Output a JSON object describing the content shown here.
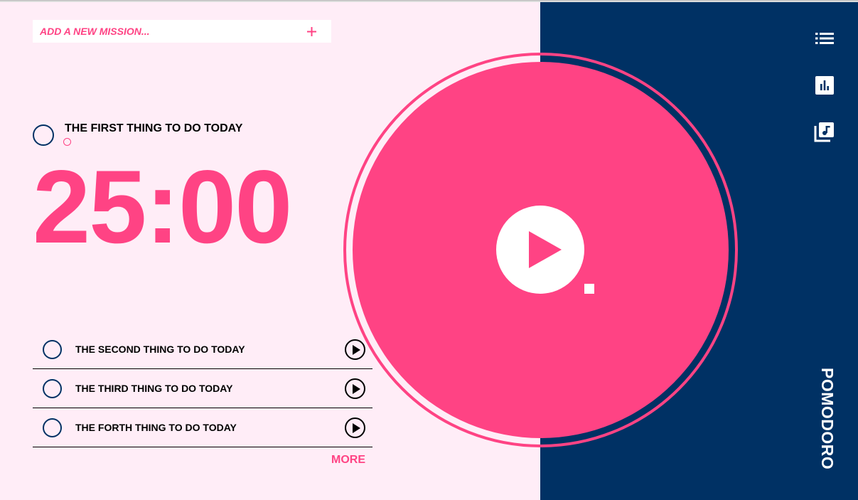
{
  "add_mission": {
    "placeholder": "ADD A NEW MISSION...",
    "add_label": "+"
  },
  "current_task": {
    "title": "THE FIRST THING TO DO TODAY",
    "timer": "25:00"
  },
  "tasks": [
    {
      "label": "THE SECOND THING TO DO TODAY"
    },
    {
      "label": "THE THIRD THING TO DO TODAY"
    },
    {
      "label": "THE FORTH THING TO DO TODAY"
    }
  ],
  "more_label": "MORE",
  "brand": "POMODORO",
  "sidebar_icons": [
    "list-icon",
    "chart-icon",
    "music-library-icon"
  ],
  "colors": {
    "accent": "#ff4384",
    "navy": "#003164",
    "background": "#ffedf7"
  }
}
